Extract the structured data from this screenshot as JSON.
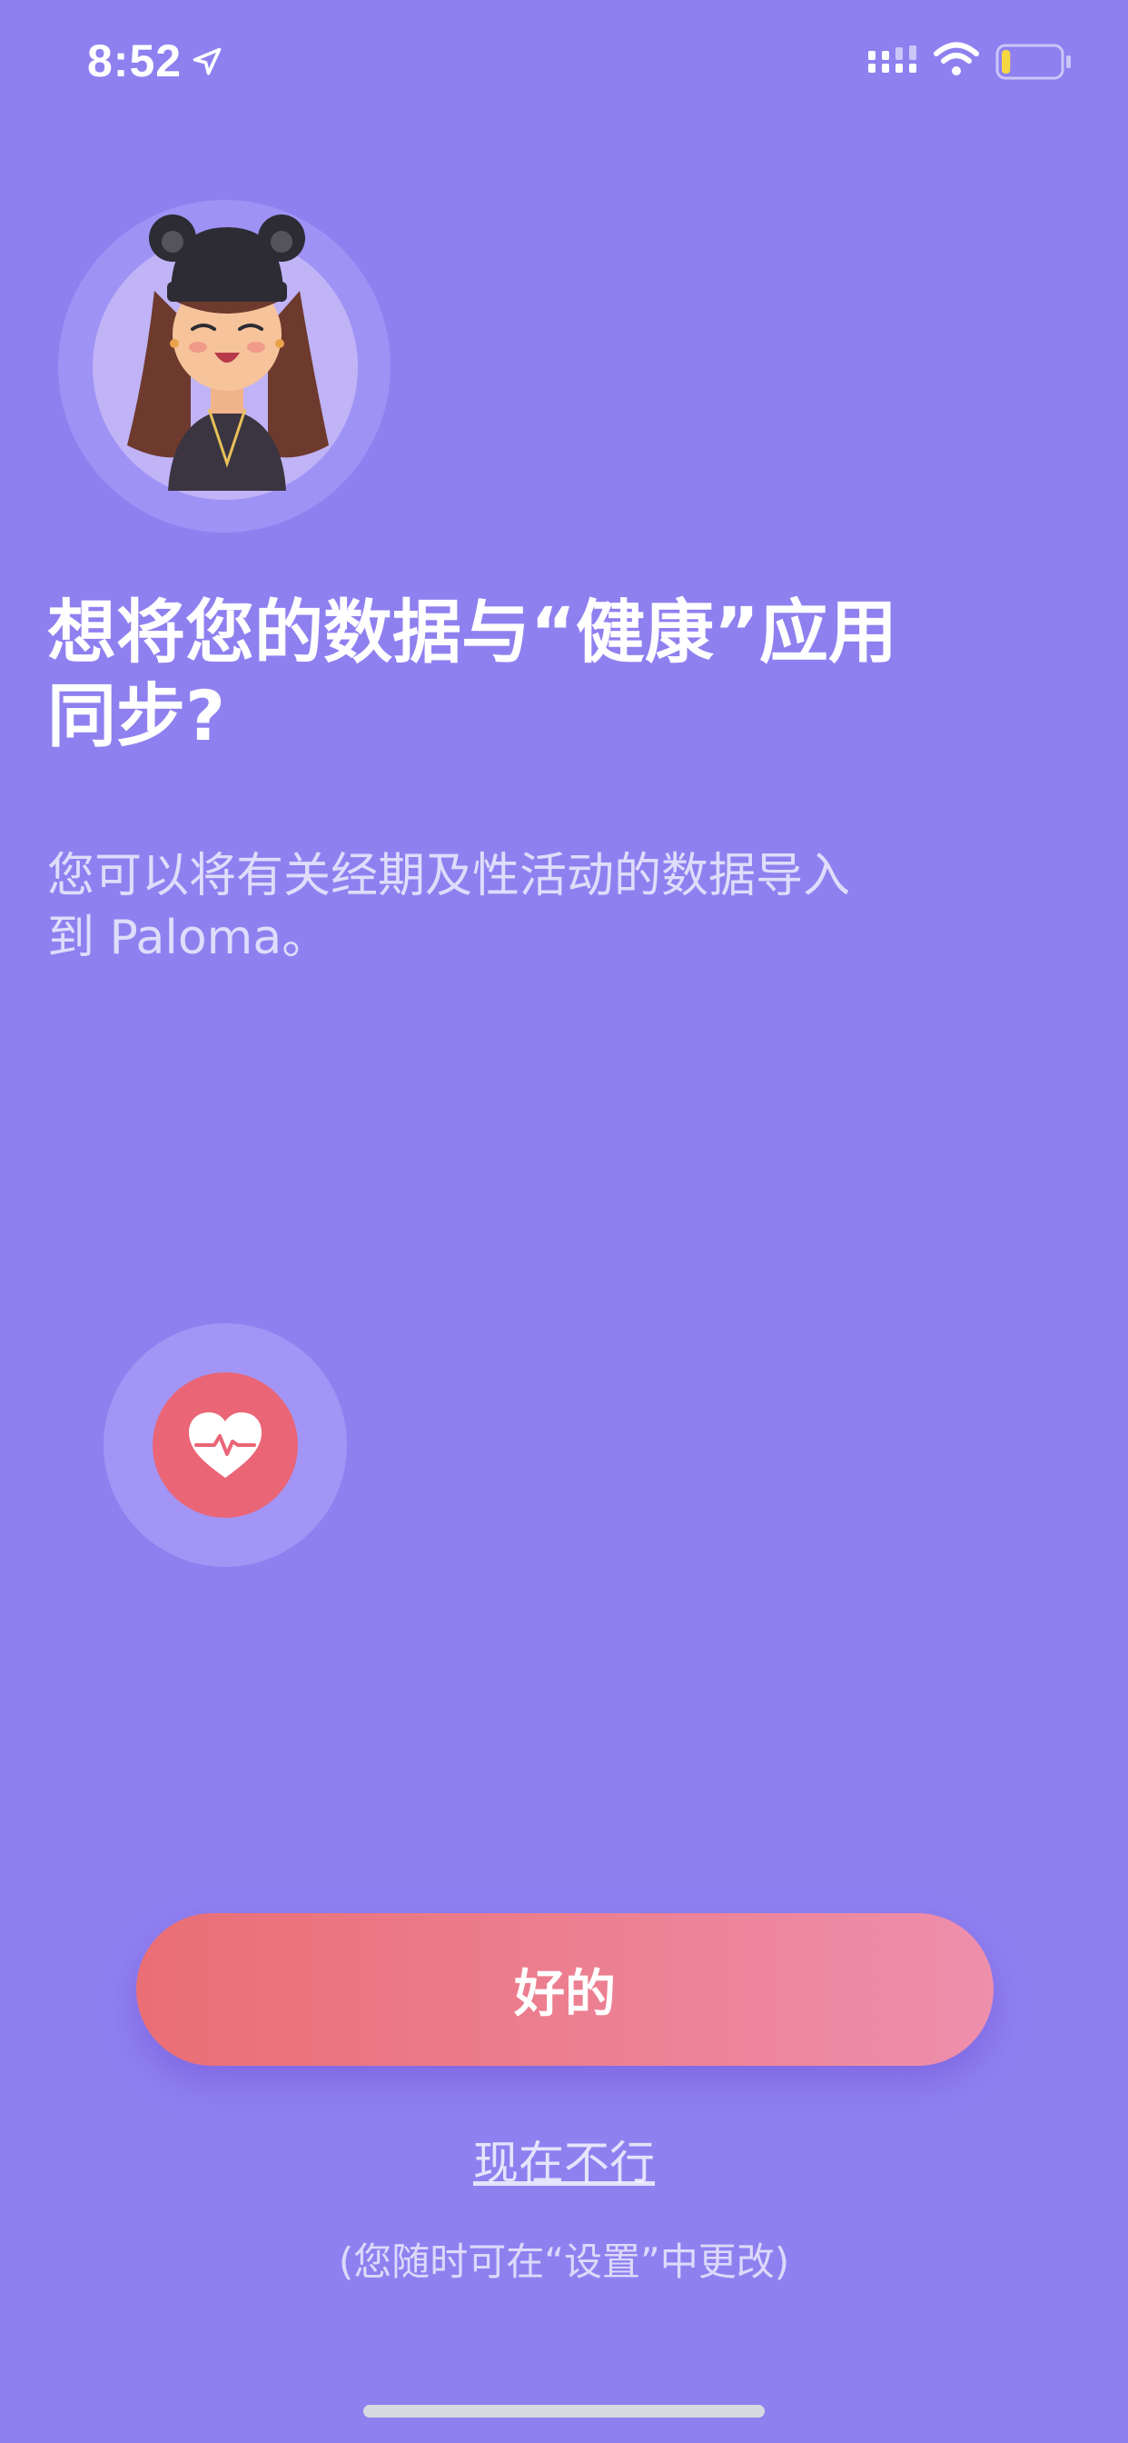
{
  "status_bar": {
    "time": "8:52",
    "icons": [
      "location-arrow-icon",
      "signal-icon",
      "wifi-icon",
      "battery-icon"
    ],
    "battery_level": 0.15
  },
  "header": {
    "avatar": "avatar-illustration",
    "title_line1": "想将您的数据与“健康”应用",
    "title_line2": "同步?",
    "subtitle_line1": "您可以将有关经期及性活动的数据导入",
    "subtitle_line2": "到 Paloma。"
  },
  "health_icon": "heart-pulse-icon",
  "actions": {
    "ok_label": "好的",
    "not_now_label": "现在不行",
    "hint": "(您随时可在“设置”中更改)"
  },
  "colors": {
    "background": "#8f80f0",
    "button_start": "#ea6e74",
    "button_end": "#ee8fac",
    "health_icon_bg": "#ea6576"
  }
}
